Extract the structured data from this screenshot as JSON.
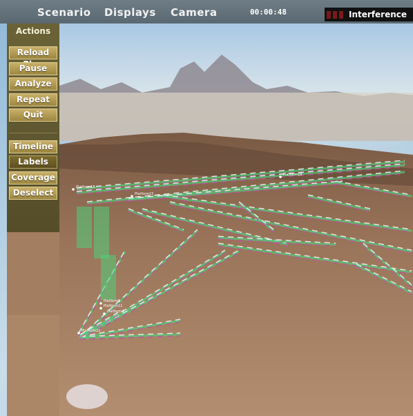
{
  "menu": {
    "scenario_label": "Scenario",
    "displays_label": "Displays",
    "camera_label": "Camera"
  },
  "timer": "00:00:48",
  "interference": {
    "label": "Interference",
    "indicators": [
      "red",
      "red",
      "red"
    ]
  },
  "actions": {
    "title": "Actions",
    "buttons": [
      {
        "label": "Reload Plan",
        "active": false
      },
      {
        "label": "Pause",
        "active": false
      },
      {
        "label": "Analyze",
        "active": false
      },
      {
        "label": "Repeat",
        "active": false
      },
      {
        "label": "Quit",
        "active": false
      }
    ],
    "display_buttons": [
      {
        "label": "Timeline",
        "active": false
      },
      {
        "label": "Labels",
        "active": true
      },
      {
        "label": "Coverage",
        "active": false
      },
      {
        "label": "Deselect",
        "active": false
      }
    ]
  },
  "scene": {
    "node_labels": [
      "Platform18",
      "Platform15",
      "Platform19",
      "Platform6",
      "Platform11",
      "Platform4",
      "Platform21"
    ],
    "colors": {
      "sky": "#bcd4e6",
      "terrain": "#8a6a4f",
      "link_green": "#4fcf7a",
      "link_magenta": "#c04fa0",
      "link_white": "#f2f2f2"
    }
  }
}
